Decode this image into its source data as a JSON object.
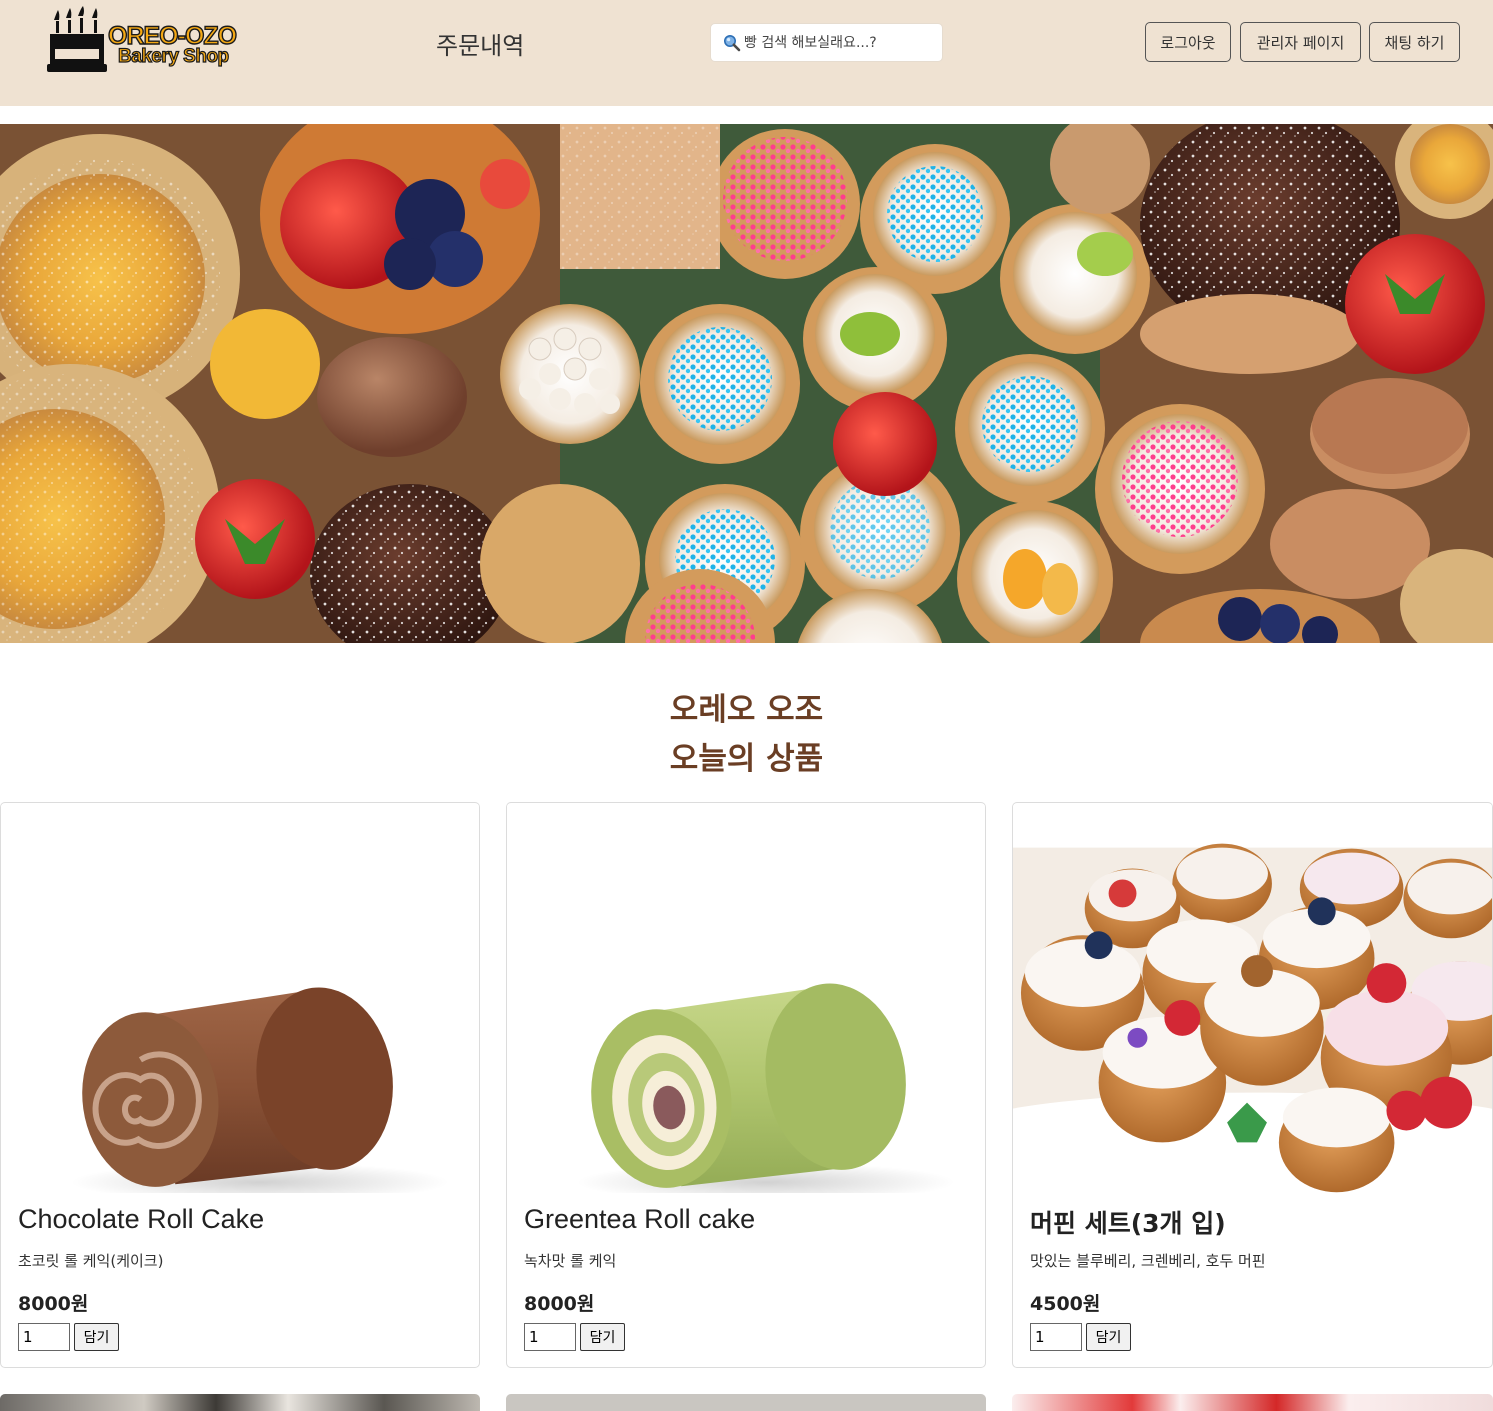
{
  "header": {
    "logo_line1": "OREO-OZO",
    "logo_line2": "Bakery Shop",
    "orders_link": "주문내역",
    "search_placeholder": "빵 검색 해보실래요...?",
    "logout_button": "로그아웃",
    "admin_button": "관리자 페이지",
    "chat_button": "채팅 하기",
    "background_color": "#efe2d2"
  },
  "section": {
    "title_line1": "오레오 오조",
    "title_line2": "오늘의 상품",
    "title_color": "#6a3e24"
  },
  "products": [
    {
      "name": "Chocolate Roll Cake",
      "description": "초코릿 롤 케익(케이크)",
      "price": "8000원",
      "quantity": "1",
      "add_label": "담기"
    },
    {
      "name": "Greentea Roll cake",
      "description": "녹차맛 롤 케익",
      "price": "8000원",
      "quantity": "1",
      "add_label": "담기"
    },
    {
      "name": "머핀 세트(3개 입)",
      "description": "맛있는 블루베리, 크렌베리, 호두 머핀",
      "price": "4500원",
      "quantity": "1",
      "add_label": "담기"
    }
  ]
}
